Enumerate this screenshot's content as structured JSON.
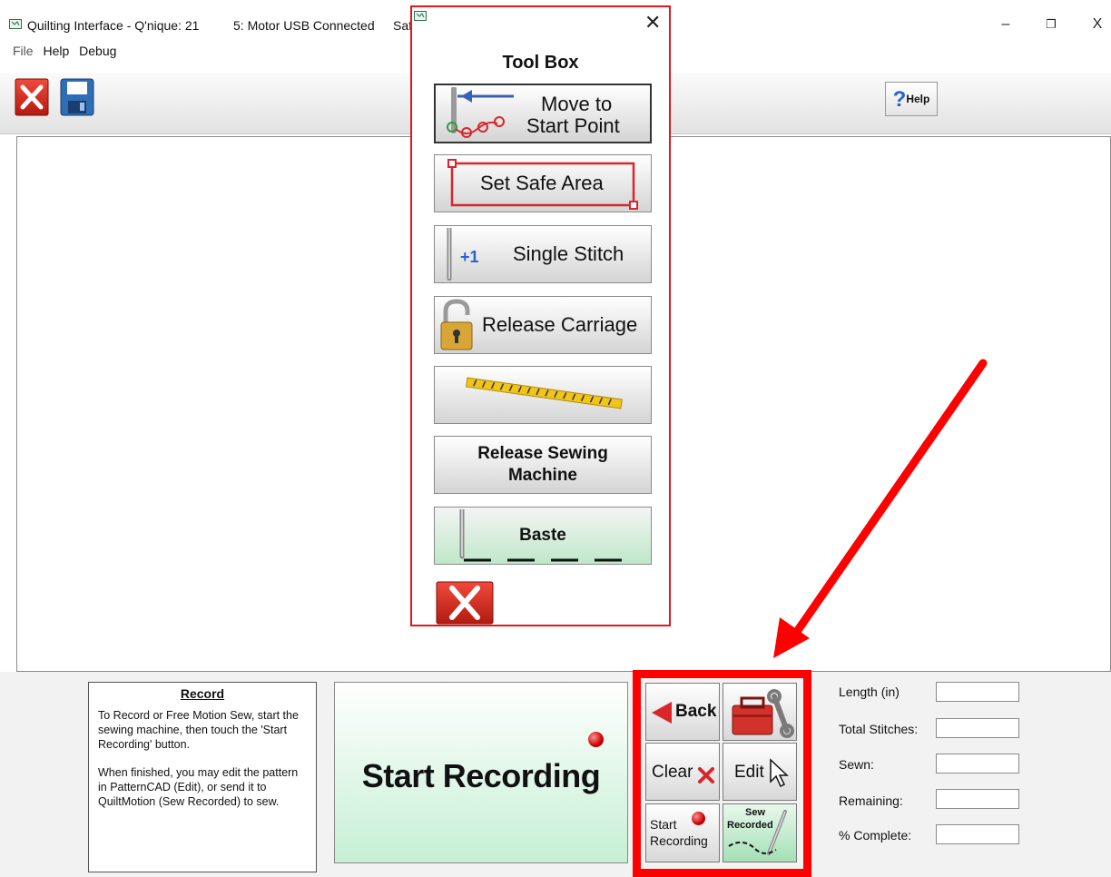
{
  "window": {
    "title": "Quilting Interface  - Q'nique: 21",
    "status": "5: Motor USB Connected",
    "status_cut": "Saf",
    "minimize": "–",
    "restore": "❐",
    "close": "X"
  },
  "menu": {
    "file": "File",
    "help": "Help",
    "debug": "Debug"
  },
  "toolbar": {
    "help_label": "Help",
    "help_q": "?"
  },
  "toolbox": {
    "title": "Tool Box",
    "close": "✕",
    "move_to_start_line1": "Move to",
    "move_to_start_line2": "Start Point",
    "set_safe_area": "Set Safe Area",
    "single_stitch_plus": "+1",
    "single_stitch": "Single Stitch",
    "release_carriage": "Release Carriage",
    "release_sewing_line1": "Release Sewing",
    "release_sewing_line2": "Machine",
    "baste": "Baste"
  },
  "info": {
    "heading": "Record",
    "para1": "To Record or Free Motion Sew, start the sewing machine, then touch the 'Start Recording' button.",
    "para2": "When finished, you may edit the pattern in PatternCAD (Edit), or send it to QuiltMotion (Sew Recorded) to sew."
  },
  "start_recording_big": "Start Recording",
  "controls": {
    "back": "Back",
    "clear": "Clear",
    "edit": "Edit",
    "start_line1": "Start",
    "start_line2": "Recording",
    "sew_line1": "Sew",
    "sew_line2": "Recorded"
  },
  "stats": {
    "length": "Length (in)",
    "total_stitches": "Total Stitches:",
    "sewn": "Sewn:",
    "remaining": "Remaining:",
    "percent_complete": "% Complete:"
  },
  "colors": {
    "highlight_red": "#ff0000",
    "toolbox_border": "#e0191c",
    "green_button": "#c6efd4",
    "help_blue": "#2b5fd6"
  }
}
